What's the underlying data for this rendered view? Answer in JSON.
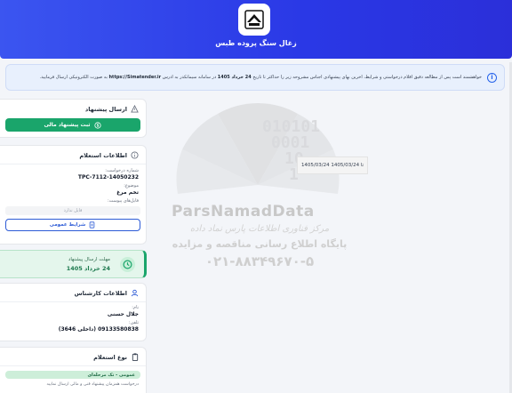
{
  "header": {
    "title": "زغال سنگ پروده طبس",
    "logo": "building-logo-icon",
    "bg_color": "#3047ea"
  },
  "notice": {
    "icon": "info-icon",
    "text_before": "خواهشمند است پس از مطالعه دقیق اقلام درخواستی و شرایط، آخرین بهای پیشنهادی اجناس مشروحه زیر را حداکثر تا تاریخ",
    "deadline_date": "24 خرداد 1405",
    "text_middle": "در سامانه سیمانکدر به آدرس",
    "website": "https://Simatender.ir",
    "text_after": "به صورت الکترونیکی ارسال فرمایید."
  },
  "submit_card": {
    "title": "ارسال پیشنهاد",
    "button_label": "ثبت پیشنهاد مالی"
  },
  "inquiry_card": {
    "title": "اطلاعات استعلام",
    "request_number_label": "شماره درخواست:",
    "request_number": "TPC-7112-14050232",
    "subject_label": "موضوع:",
    "subject": "تخم مرغ",
    "attachments_label": "فایل‌های پیوست:",
    "no_file": "فایل ندارد",
    "terms_button": "شرایط عمومی"
  },
  "deadline_card": {
    "label": "مهلت ارسال پیشنهاد",
    "date": "24 خرداد 1405",
    "icon": "clock-icon"
  },
  "expert_card": {
    "title": "اطلاعات کارشناس",
    "name_label": "نام:",
    "name": "جلال حسنی",
    "phone_label": "تلفن:",
    "phone": "09133580838 (داخلی 3646)"
  },
  "type_card": {
    "title": "نوع استعلام",
    "badge": "عمومی - تک مرحله‌ای",
    "note": "درخواست همزمان پیشنهاد فنی و مالی ارسال نمایید"
  },
  "watermark": {
    "brand": "ParsNamadData",
    "line1": "مرکز فناوری اطلاعات پارس نماد داده",
    "line2": "پایگاه اطلاع رسانی مناقصه و مزایده",
    "phone": "۰۲۱-۸۸۳۴۹۶۷۰-۵"
  },
  "date_tag": "1405/03/24 تا 1405/03/24"
}
